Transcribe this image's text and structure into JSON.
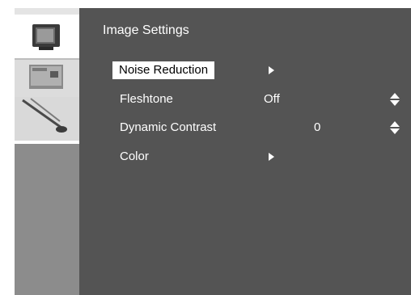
{
  "menu": {
    "title": "Image Settings",
    "items": [
      {
        "label": "Noise Reduction",
        "value": "",
        "control": "submenu-arrow",
        "selected": true
      },
      {
        "label": "Fleshtone",
        "value": "Off",
        "control": "up-down-arrows",
        "selected": false
      },
      {
        "label": "Dynamic Contrast",
        "value": "0",
        "control": "up-down-arrows",
        "selected": false
      },
      {
        "label": "Color",
        "value": "",
        "control": "submenu-arrow",
        "selected": false
      }
    ]
  },
  "sidebar": {
    "tabs": [
      {
        "icon": "tv-picture-icon",
        "active": true
      },
      {
        "icon": "display-icon",
        "active": false
      },
      {
        "icon": "tools-icon",
        "active": false
      }
    ]
  },
  "colors": {
    "panel": "#545454",
    "sidebar": "#8c8c8c",
    "highlight": "#ffffff",
    "text": "#ffffff"
  }
}
